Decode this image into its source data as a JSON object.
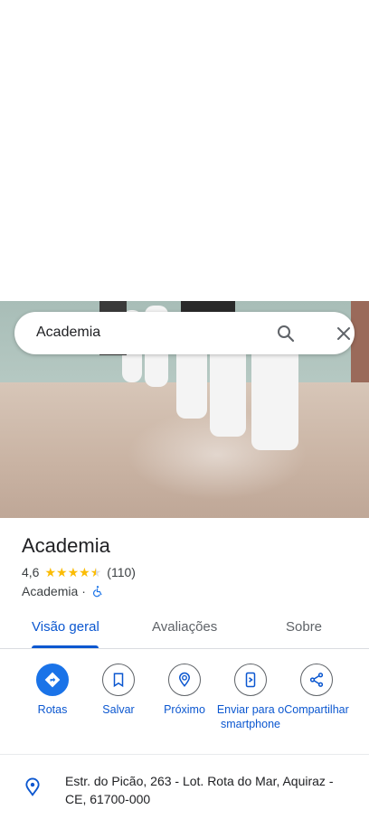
{
  "search": {
    "query": "Academia"
  },
  "place": {
    "name": "Academia",
    "rating": "4,6",
    "stars_value": 4.5,
    "review_count": "(110)",
    "category": "Academia",
    "separator": "·"
  },
  "tabs": [
    {
      "label": "Visão geral",
      "active": true
    },
    {
      "label": "Avaliações",
      "active": false
    },
    {
      "label": "Sobre",
      "active": false
    }
  ],
  "actions": [
    {
      "label": "Rotas",
      "icon": "directions-icon"
    },
    {
      "label": "Salvar",
      "icon": "bookmark-icon"
    },
    {
      "label": "Próximo",
      "icon": "nearby-icon"
    },
    {
      "label": "Enviar para o smartphone",
      "icon": "send-to-phone-icon"
    },
    {
      "label": "Compartilhar",
      "icon": "share-icon"
    }
  ],
  "address": "Estr. do Picão, 263 - Lot. Rota do Mar, Aquiraz - CE, 61700-000",
  "colors": {
    "accent": "#0b57d0",
    "primary_button": "#1a73e8",
    "star": "#fbbc04"
  }
}
